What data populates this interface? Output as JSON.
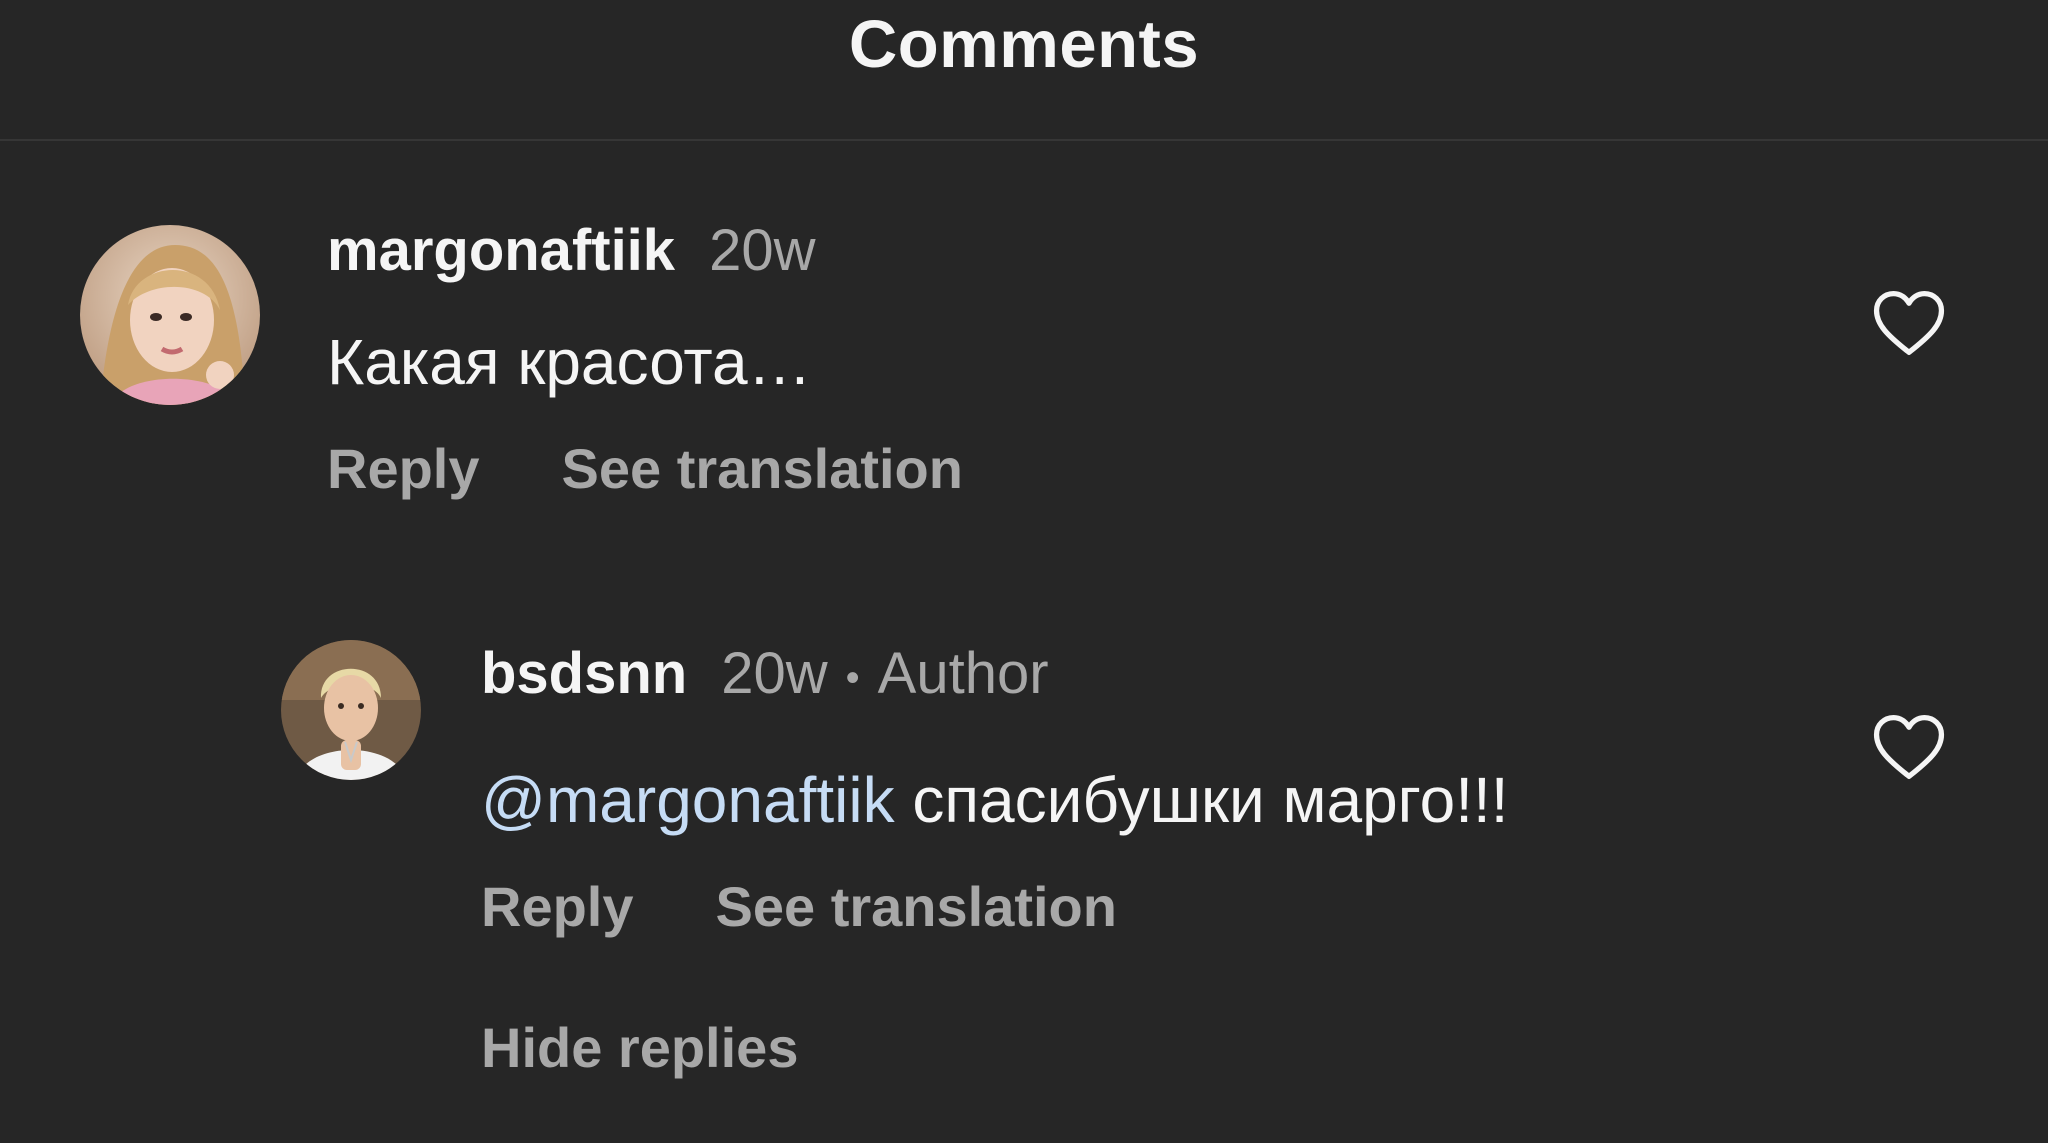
{
  "header": {
    "title": "Comments"
  },
  "comments": [
    {
      "username": "margonaftiik",
      "time": "20w",
      "text": "Какая красота…",
      "reply_label": "Reply",
      "translate_label": "See translation",
      "like_icon": "heart-outline-icon",
      "avatar_icon": "profile-photo"
    }
  ],
  "replies": [
    {
      "username": "bsdsnn",
      "time": "20w",
      "separator": "•",
      "badge": "Author",
      "mention": "@margonaftiik",
      "text": " спасибушки марго!!!",
      "reply_label": "Reply",
      "translate_label": "See translation",
      "like_icon": "heart-outline-icon",
      "avatar_icon": "profile-photo"
    }
  ],
  "hide_replies_label": "Hide replies",
  "colors": {
    "background": "#262626",
    "primary_text": "#f5f5f5",
    "secondary_text": "#a8a8a8",
    "mention": "#c6dcf5",
    "divider": "#363636"
  }
}
